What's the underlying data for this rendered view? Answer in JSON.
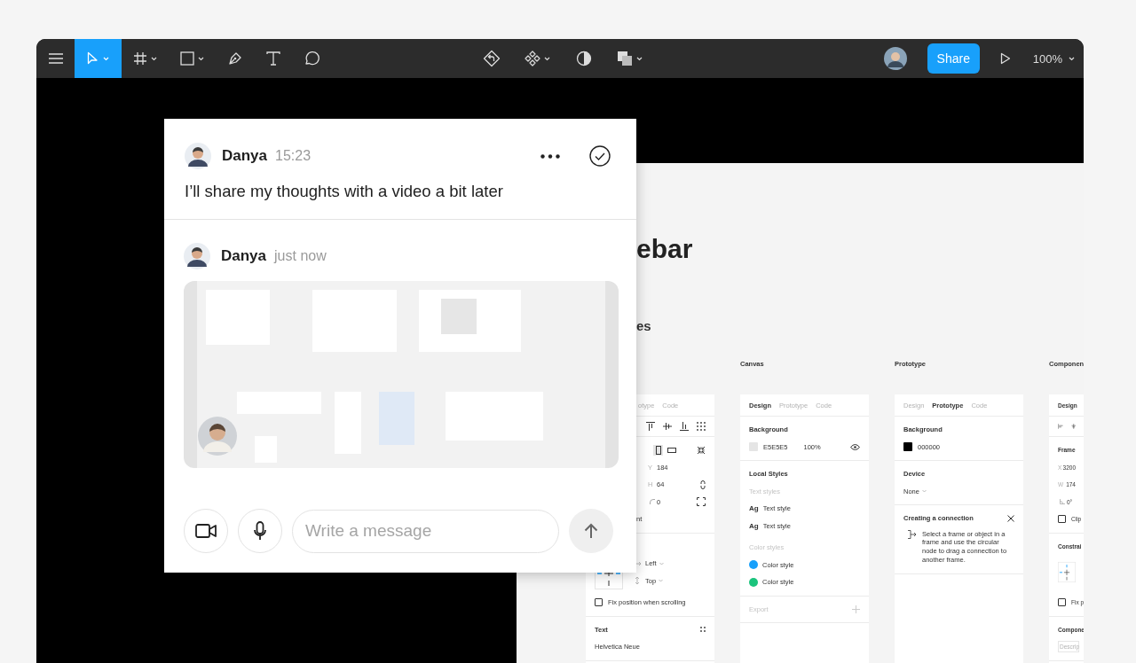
{
  "toolbar": {
    "tools": [
      {
        "kind": "menu",
        "selected": false,
        "caret": false
      },
      {
        "kind": "move",
        "selected": true,
        "caret": true
      },
      {
        "kind": "frame",
        "selected": false,
        "caret": true
      },
      {
        "kind": "rectangle",
        "selected": false,
        "caret": true
      },
      {
        "kind": "pen",
        "selected": false,
        "caret": false
      },
      {
        "kind": "text",
        "selected": false,
        "caret": false
      },
      {
        "kind": "comment",
        "selected": false,
        "caret": false
      }
    ],
    "actions": [
      {
        "kind": "return",
        "caret": false
      },
      {
        "kind": "components",
        "caret": true
      },
      {
        "kind": "contrast",
        "caret": false
      },
      {
        "kind": "boolean",
        "caret": true
      }
    ],
    "share": "Share",
    "zoom": "100%"
  },
  "comment_panel": {
    "messages": [
      {
        "kind": "text",
        "author": "Danya",
        "time": "15:23",
        "text": "I’ll share my thoughts with a video a bit later"
      },
      {
        "kind": "video",
        "author": "Danya",
        "time": "just now"
      }
    ],
    "composer": {
      "placeholder": "Write a message"
    }
  },
  "canvas": {
    "heading": "ebar",
    "subheading": "es",
    "covered_panel": {
      "tabs": [
        {
          "label": "otype",
          "selected": false
        },
        {
          "label": "Code",
          "selected": false
        }
      ],
      "align": [
        {
          "kind": "align-top"
        },
        {
          "kind": "align-middle"
        },
        {
          "kind": "align-bottom"
        },
        {
          "kind": "distribute"
        }
      ],
      "orientation": [
        {
          "kind": "portrait",
          "selected": true
        },
        {
          "kind": "landscape",
          "selected": false
        }
      ],
      "fields": [
        {
          "label": "Y",
          "value": "184"
        },
        {
          "label": "H",
          "value": "64"
        }
      ],
      "radius": "0",
      "cut_label": "nt",
      "constraints": [
        {
          "kind": "horizontal",
          "value": "Left"
        },
        {
          "kind": "vertical",
          "value": "Top"
        }
      ],
      "fix_position": {
        "label": "Fix position when scrolling",
        "checked": false
      },
      "text_section": {
        "title": "Text",
        "font": "Helvetica Neue"
      }
    },
    "columns": [
      {
        "header": "Canvas",
        "sections": [
          {
            "rows": [
              {
                "kind": "tabs",
                "items": [
                  {
                    "label": "Design",
                    "selected": true
                  },
                  {
                    "label": "Prototype",
                    "selected": false
                  },
                  {
                    "label": "Code",
                    "selected": false
                  }
                ]
              }
            ]
          },
          {
            "rows": [
              {
                "kind": "title",
                "text": "Background",
                "disabled": false
              },
              {
                "kind": "swatch",
                "color": "#e5e5e5",
                "value": "E5E5E5",
                "opacity": "100%",
                "eye": true
              }
            ]
          },
          {
            "rows": [
              {
                "kind": "title",
                "text": "Local Styles",
                "disabled": false
              },
              {
                "kind": "hint",
                "text": "Text styles"
              },
              {
                "kind": "text-style",
                "sample": "Ag",
                "label": "Text style"
              },
              {
                "kind": "text-style",
                "sample": "Ag",
                "label": "Text style"
              },
              {
                "kind": "hint",
                "text": "Color styles"
              },
              {
                "kind": "color-style",
                "color": "#18a0fb",
                "label": "Color style"
              },
              {
                "kind": "color-style",
                "color": "#1bc47d",
                "label": "Color style"
              }
            ]
          },
          {
            "rows": [
              {
                "kind": "title-plus",
                "text": "Export",
                "disabled": true
              }
            ]
          }
        ]
      },
      {
        "header": "Prototype",
        "sections": [
          {
            "rows": [
              {
                "kind": "tabs",
                "items": [
                  {
                    "label": "Design",
                    "selected": false
                  },
                  {
                    "label": "Prototype",
                    "selected": true
                  },
                  {
                    "label": "Code",
                    "selected": false
                  }
                ]
              }
            ]
          },
          {
            "rows": [
              {
                "kind": "title",
                "text": "Background",
                "disabled": false
              },
              {
                "kind": "swatch",
                "color": "#000000",
                "value": "000000",
                "eye": false
              }
            ]
          },
          {
            "rows": [
              {
                "kind": "title",
                "text": "Device",
                "disabled": false
              },
              {
                "kind": "dropdown",
                "value": "None"
              }
            ]
          },
          {
            "rows": [
              {
                "kind": "title-close",
                "text": "Creating a connection",
                "disabled": false
              },
              {
                "kind": "note",
                "text": "Select a frame or object in a frame and use the circular node to drag a connection to another frame."
              }
            ]
          }
        ]
      },
      {
        "header": "Componen",
        "sections": [
          {
            "rows": [
              {
                "kind": "tabs",
                "items": [
                  {
                    "label": "Design",
                    "selected": true
                  }
                ]
              }
            ]
          },
          {
            "rows": [
              {
                "kind": "align-icons",
                "items": [
                  {
                    "kind": "align-left"
                  },
                  {
                    "kind": "align-center"
                  }
                ]
              }
            ]
          },
          {
            "rows": [
              {
                "kind": "title-dropdown",
                "text": "Frame",
                "disabled": false
              },
              {
                "kind": "field",
                "label": "X",
                "value": "3200"
              },
              {
                "kind": "field",
                "label": "W",
                "value": "174"
              },
              {
                "kind": "angle-field",
                "value": "0°"
              },
              {
                "kind": "checkbox",
                "label": "Clip",
                "checked": false
              }
            ]
          },
          {
            "rows": [
              {
                "kind": "title",
                "text": "Constrai",
                "disabled": false
              },
              {
                "kind": "constraints"
              },
              {
                "kind": "checkbox",
                "label": "Fix p",
                "checked": false
              }
            ]
          },
          {
            "rows": [
              {
                "kind": "title",
                "text": "Compone",
                "disabled": false
              },
              {
                "kind": "input",
                "placeholder": "Descrip"
              }
            ]
          }
        ]
      }
    ]
  }
}
